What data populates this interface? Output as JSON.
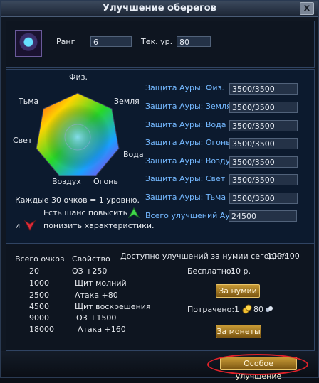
{
  "window": {
    "title": "Улучшение оберегов",
    "close_label": "x"
  },
  "top": {
    "rank_label": "Ранг",
    "rank_value": "6",
    "tech_label": "Тек. ур.",
    "tech_value": "80",
    "emblem_icon": "amulet-icon"
  },
  "radar": {
    "axes": [
      "Физ.",
      "Земля",
      "Вода",
      "Огонь",
      "Воздух",
      "Свет",
      "Тьма"
    ]
  },
  "aura": {
    "rows": [
      {
        "label": "Защита Ауры: Физ.",
        "value": "3500/3500"
      },
      {
        "label": "Защита Ауры: Земля",
        "value": "3500/3500"
      },
      {
        "label": "Защита Ауры: Вода",
        "value": "3500/3500"
      },
      {
        "label": "Защита Ауры: Огонь",
        "value": "3500/3500"
      },
      {
        "label": "Защита Ауры: Воздух",
        "value": "3500/3500"
      },
      {
        "label": "Защита Ауры: Свет",
        "value": "3500/3500"
      },
      {
        "label": "Защита Ауры: Тьма",
        "value": "3500/3500"
      }
    ],
    "total_label": "Всего улучшений Ауры",
    "total_value": "24500"
  },
  "info": {
    "line1": "Каждые 30 очков = 1 уровню.",
    "line2": "Есть шанс повысить",
    "line3_prefix": "и",
    "line3": "понизить характеристики.",
    "up_icon": "green-arrow-up-icon",
    "down_icon": "red-arrow-down-icon"
  },
  "table": {
    "col1": "Всего очков",
    "col2": "Свойство",
    "rows": [
      {
        "points": "20",
        "prop": "ОЗ +250"
      },
      {
        "points": "1000",
        "prop": "Щит молний"
      },
      {
        "points": "2500",
        "prop": "Атака +80"
      },
      {
        "points": "4500",
        "prop": "Щит воскрешения"
      },
      {
        "points": "9000",
        "prop": "ОЗ +1500"
      },
      {
        "points": "18000",
        "prop": "Атака +160"
      }
    ]
  },
  "upgrade": {
    "daily_label": "Доступно улучшений за нумии сегодня:",
    "daily_value": "100/100",
    "free_label": "Бесплатно:",
    "free_value": "10 р.",
    "numii_button": "За нумии",
    "spent_label": "Потрачено:",
    "spent_count": "1",
    "spent_amount": "80",
    "coin_icon": "gold-coin-icon",
    "gem_icon": "numii-icon",
    "coins_button": "За монеты",
    "special_button": "Особое улучшение"
  },
  "colors": {
    "aura_label": "#74b8ff",
    "highlight": "#e0222a"
  }
}
